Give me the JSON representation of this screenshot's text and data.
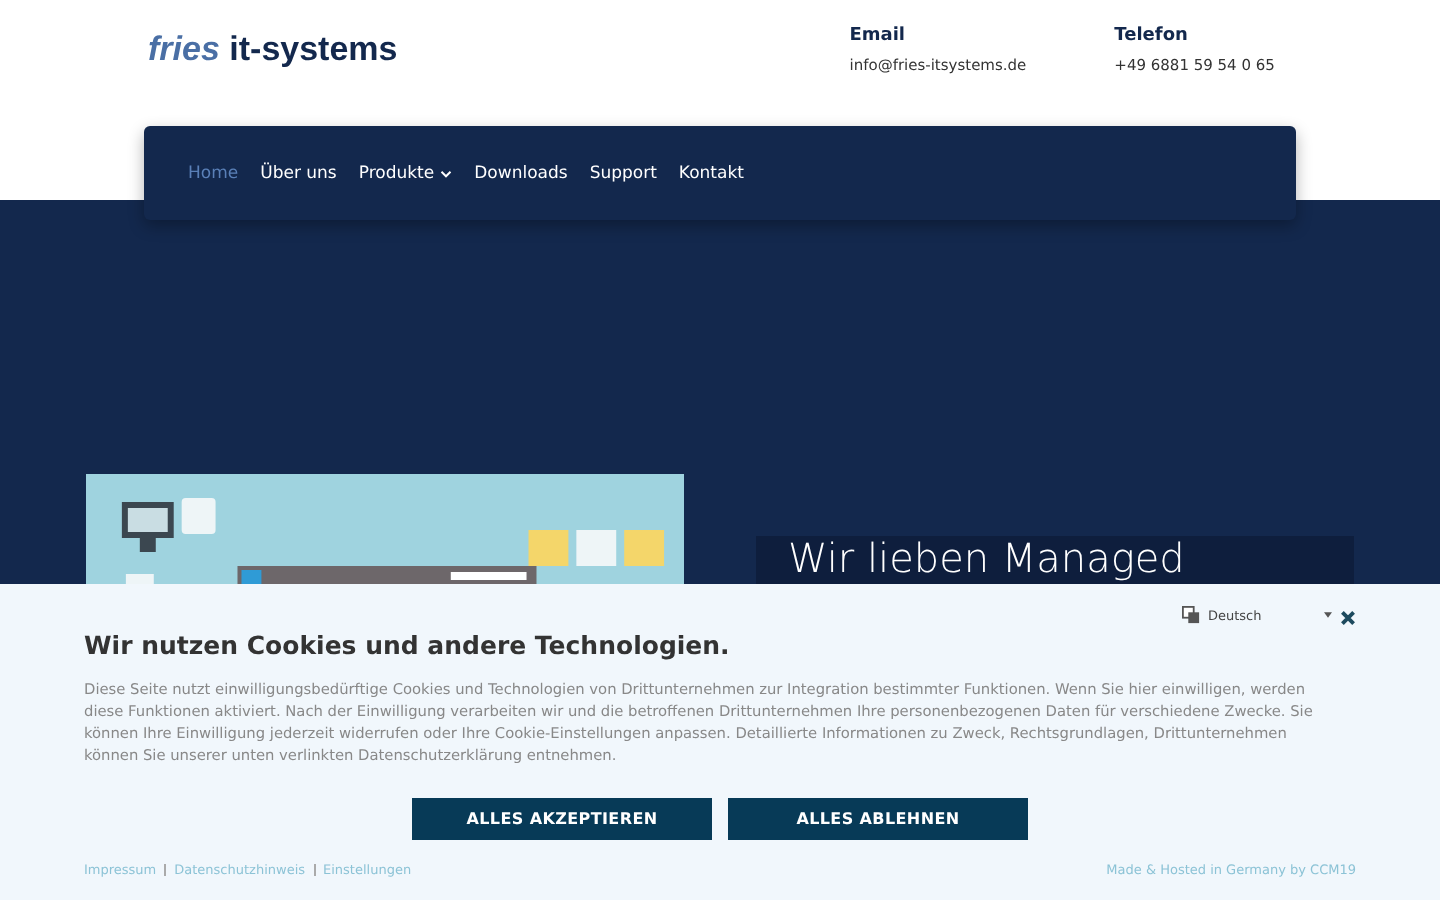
{
  "logo": {
    "first": "fries",
    "second": "it-systems"
  },
  "contacts": [
    {
      "label": "Email",
      "value": "info@fries-itsystems.de"
    },
    {
      "label": "Telefon",
      "value": "+49 6881 59 54 0 65"
    }
  ],
  "nav": [
    {
      "label": "Home",
      "selected": true,
      "dropdown": false
    },
    {
      "label": "Über uns",
      "selected": false,
      "dropdown": false
    },
    {
      "label": "Produkte",
      "selected": false,
      "dropdown": true
    },
    {
      "label": "Downloads",
      "selected": false,
      "dropdown": false
    },
    {
      "label": "Support",
      "selected": false,
      "dropdown": false
    },
    {
      "label": "Kontakt",
      "selected": false,
      "dropdown": false
    }
  ],
  "hero": {
    "heading": "Wir lieben Managed"
  },
  "cookie_banner": {
    "language": "Deutsch",
    "title": "Wir nutzen Cookies und andere Technologien.",
    "text": "Diese Seite nutzt einwilligungsbedürftige Cookies und Technologien von Drittunternehmen zur Integration bestimmter Funktionen. Wenn Sie hier einwilligen, werden diese Funktionen aktiviert. Nach der Einwilligung verarbeiten wir und die betroffenen Drittunternehmen Ihre personenbezogenen Daten für verschiedene Zwecke. Sie können Ihre Einwilligung jederzeit widerrufen oder Ihre Cookie-Einstellungen anpassen. Detaillierte Informationen zu Zweck, Rechtsgrundlagen, Drittunternehmen können Sie unserer unten verlinkten Datenschutzerklärung entnehmen.",
    "buttons": [
      "ALLES AKZEPTIEREN",
      "ALLES ABLEHNEN"
    ],
    "links": [
      "Impressum",
      "Datenschutzhinweis",
      "Einstellungen"
    ],
    "credit": "Made & Hosted in Germany by CCM19"
  }
}
